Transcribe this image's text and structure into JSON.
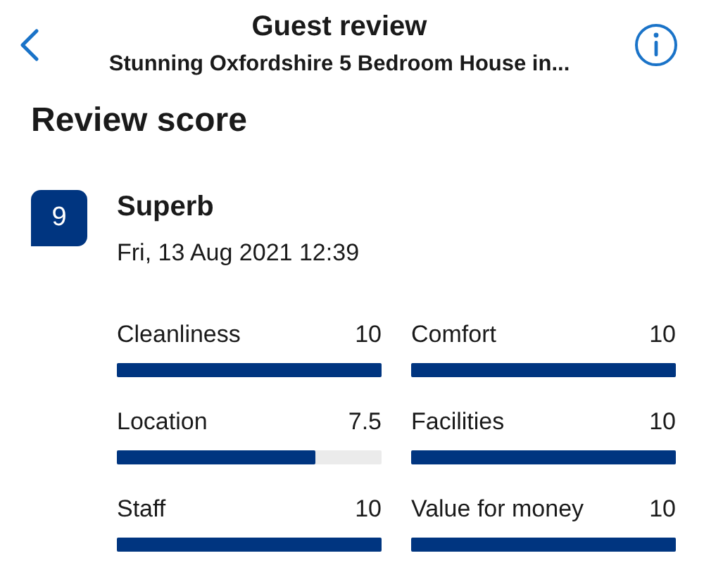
{
  "header": {
    "title": "Guest review",
    "subtitle": "Stunning Oxfordshire 5 Bedroom House in..."
  },
  "section_title": "Review score",
  "review": {
    "score": "9",
    "rating": "Superb",
    "date": "Fri, 13 Aug 2021 12:39"
  },
  "categories": [
    {
      "name": "Cleanliness",
      "score": "10",
      "level": 1
    },
    {
      "name": "Comfort",
      "score": "10",
      "level": 1
    },
    {
      "name": "Location",
      "score": "7.5",
      "level": 0.75
    },
    {
      "name": "Facilities",
      "score": "10",
      "level": 1
    },
    {
      "name": "Staff",
      "score": "10",
      "level": 1
    },
    {
      "name": "Value for money",
      "score": "10",
      "level": 1
    }
  ]
}
